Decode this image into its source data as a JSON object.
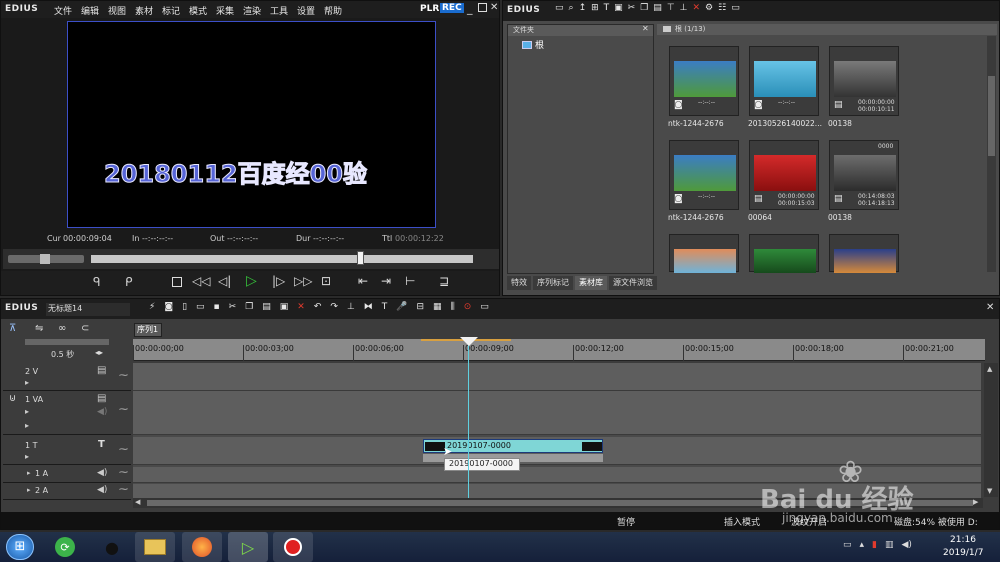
{
  "player": {
    "logo": "EDIUS",
    "menu": [
      "文件",
      "编辑",
      "视图",
      "素材",
      "标记",
      "模式",
      "采集",
      "渲染",
      "工具",
      "设置",
      "帮助"
    ],
    "mode_plr": "PLR",
    "mode_rec": "REC",
    "title_text": "20180112百度经00验",
    "cur_label": "Cur",
    "cur_value": "00:00:09:04",
    "in_label": "In",
    "in_value": "--:--:--:--",
    "out_label": "Out",
    "out_value": "--:--:--:--",
    "dur_label": "Dur",
    "dur_value": "--:--:--:--",
    "ttl_label": "Ttl",
    "ttl_value": "00:00:12:22"
  },
  "bin": {
    "logo": "EDIUS",
    "folder_panel_title": "文件夹",
    "root_label": "根",
    "breadcrumb": "根 (1/13)",
    "tabs": [
      "特效",
      "序列标记",
      "素材库",
      "源文件浏览"
    ],
    "clips": [
      {
        "name": "ntk-1244-2676",
        "tc1": "--:--:--",
        "tc2": "",
        "kind": "photo",
        "c1": "#3b7dc4",
        "c2": "#4f9a3a"
      },
      {
        "name": "20130526140022...",
        "tc1": "--:--:--",
        "tc2": "",
        "kind": "photo",
        "c1": "#67c3e6",
        "c2": "#2a8fb8"
      },
      {
        "name": "00138",
        "tc1": "00:00:00:00",
        "tc2": "00:00:10:11",
        "kind": "video",
        "c1": "#7a7a7a",
        "c2": "#333333"
      },
      {
        "name": "ntk-1244-2676",
        "tc1": "--:--:--",
        "tc2": "",
        "kind": "photo",
        "c1": "#3b7dc4",
        "c2": "#4f9a3a"
      },
      {
        "name": "00064",
        "tc1": "00:00:00:00",
        "tc2": "00:00:15:03",
        "kind": "video",
        "c1": "#d42a2a",
        "c2": "#8a0f0f"
      },
      {
        "name": "00138",
        "tc1": "00:14:08:03",
        "tc2": "00:14:18:13",
        "kind": "video",
        "c1": "#6d6d6d",
        "c2": "#2c2c2c",
        "badge": "0000"
      },
      {
        "name": "",
        "tc1": "",
        "tc2": "",
        "kind": "photo",
        "c1": "#e08c5a",
        "c2": "#6fb3d9"
      },
      {
        "name": "",
        "tc1": "",
        "tc2": "",
        "kind": "photo",
        "c1": "#2f8a3a",
        "c2": "#164a1c"
      },
      {
        "name": "",
        "tc1": "",
        "tc2": "",
        "kind": "photo",
        "c1": "#2a3f8a",
        "c2": "#d68a3a"
      }
    ]
  },
  "timeline": {
    "logo": "EDIUS",
    "project_name": "无标题14",
    "sequence_tab": "序列1",
    "zoom_label": "0.5 秒",
    "ruler": [
      "00:00:00;00",
      "00:00:03;00",
      "00:00:06;00",
      "00:00:09;00",
      "00:00:12;00",
      "00:00:15;00",
      "00:00:18;00",
      "00:00:21;00"
    ],
    "tracks": [
      {
        "name": "2 V"
      },
      {
        "name": "1 VA"
      },
      {
        "name": "1 T"
      },
      {
        "name": "1 A"
      },
      {
        "name": "2 A"
      }
    ],
    "title_clip": "20190107-0000",
    "tooltip": "20190107-0000",
    "status": {
      "pause": "暂停",
      "insert_mode": "插入模式",
      "ripple": "波纹开启",
      "disk": "磁盘:54% 被使用 D:"
    }
  },
  "taskbar": {
    "time": "21:16",
    "date": "2019/1/7"
  },
  "watermark": {
    "brand": "Bai du 经验",
    "url": "jingyan.baidu.com"
  },
  "colors": {
    "accent_blue": "#1a6ccf",
    "play_green": "#35c23a",
    "clip_cyan": "#7fd6d6",
    "close_red": "#e23b2e"
  }
}
